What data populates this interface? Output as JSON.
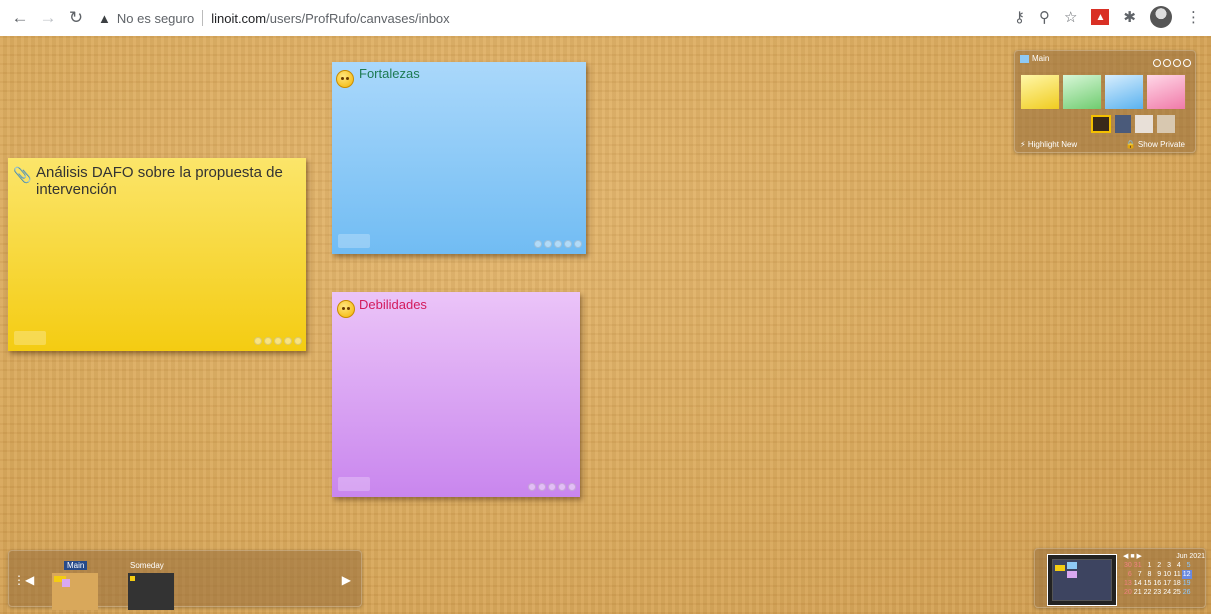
{
  "browser": {
    "not_secure_label": "No es seguro",
    "url_domain": "linoit.com",
    "url_path": "/users/ProfRufo/canvases/inbox",
    "icons": [
      "back-arrow-icon",
      "forward-arrow-icon",
      "reload-icon",
      "warning-icon",
      "key-icon",
      "zoom-icon",
      "star-icon",
      "extension-icon",
      "puzzle-icon",
      "profile-avatar",
      "menu-icon"
    ]
  },
  "board": {
    "stickies": [
      {
        "title": "Análisis DAFO sobre la propuesta de intervención",
        "color": "#f5d22a",
        "title_color": "#333333"
      },
      {
        "title": "Fortalezas",
        "color": "#8fcaf5",
        "title_color": "#1d7a52"
      },
      {
        "title": "Debilidades",
        "color": "#d9a8f0",
        "title_color": "#d31a5c"
      }
    ]
  },
  "palette_panel": {
    "title": "Main",
    "highlight_label": "⚡ Highlight New",
    "private_label": "🔒 Show Private",
    "colors": [
      "#f7e15a",
      "#a8e6a8",
      "#8fcaf5",
      "#f5a8c8"
    ]
  },
  "canvas_bar": {
    "canvases": [
      {
        "label": "Main"
      },
      {
        "label": "Someday"
      }
    ]
  },
  "calendar": {
    "month": "Jun 2021",
    "rows": [
      [
        "30",
        "31",
        "1",
        "2",
        "3",
        "4",
        "5"
      ],
      [
        "6",
        "7",
        "8",
        "9",
        "10",
        "11",
        "12"
      ],
      [
        "13",
        "14",
        "15",
        "16",
        "17",
        "18",
        "19"
      ],
      [
        "20",
        "21",
        "22",
        "23",
        "24",
        "25",
        "26"
      ]
    ]
  }
}
